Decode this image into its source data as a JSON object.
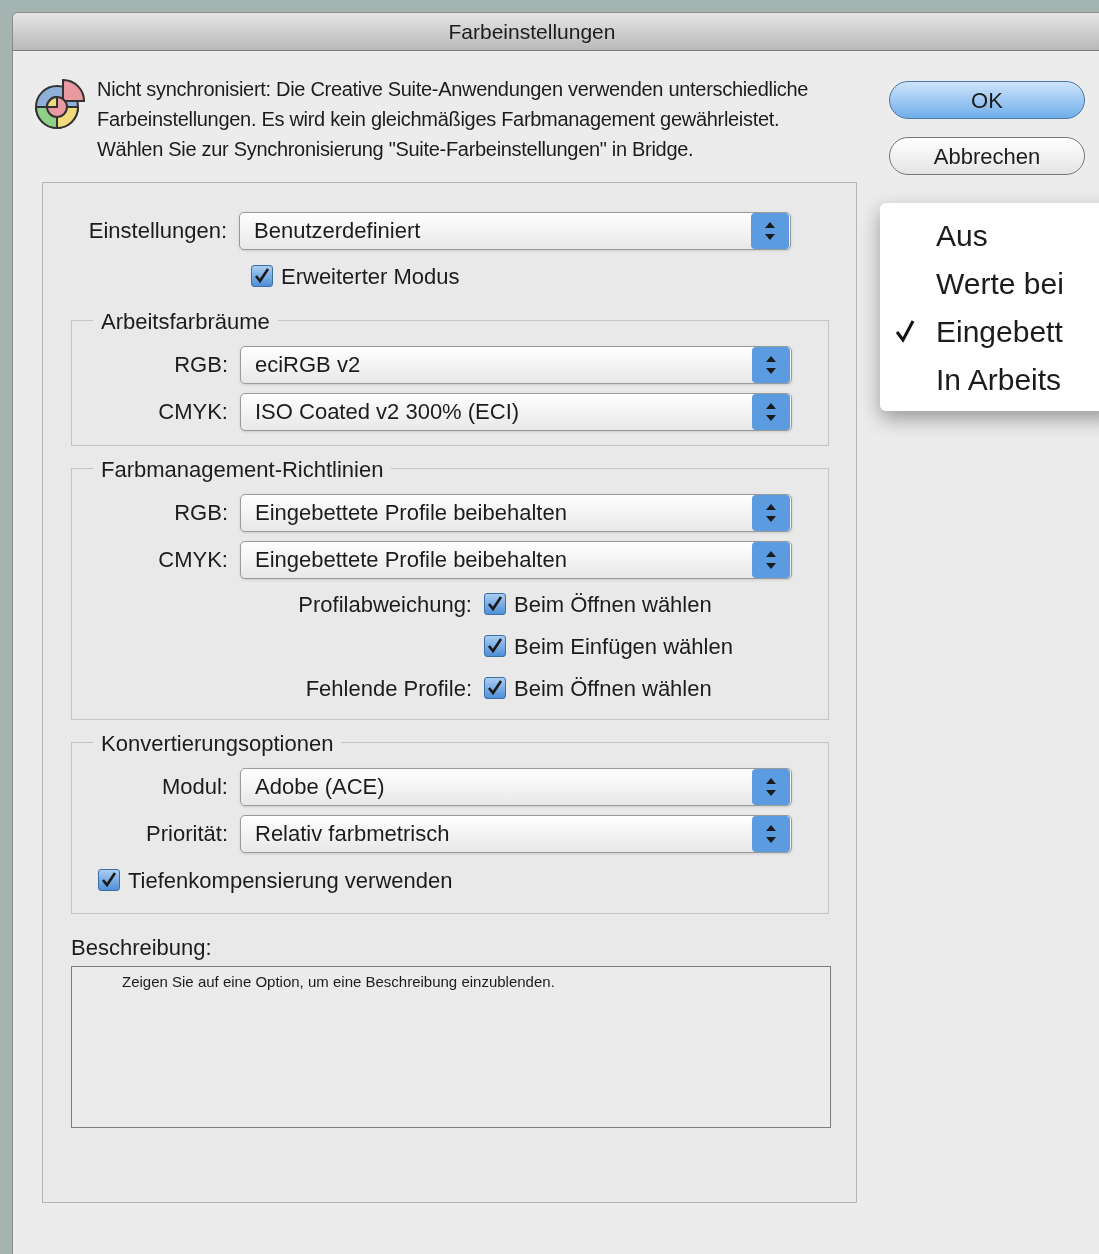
{
  "window": {
    "title": "Farbeinstellungen"
  },
  "message": "Nicht synchronisiert: Die Creative Suite-Anwendungen verwenden unterschiedliche Farbeinstellungen. Es wird kein gleichmäßiges Farbmanagement gewährleistet. Wählen Sie zur Synchronisierung \"Suite-Farbeinstellungen\" in Bridge.",
  "buttons": [
    {
      "label": "OK",
      "default": true
    },
    {
      "label": "Abbrechen",
      "default": false
    }
  ],
  "popup_menu": {
    "items": [
      {
        "label": "Aus",
        "selected": false
      },
      {
        "label": "Werte bei",
        "selected": false
      },
      {
        "label": "Eingebett",
        "selected": true
      },
      {
        "label": "In Arbeits",
        "selected": false
      }
    ]
  },
  "settings": {
    "label": "Einstellungen:",
    "value": "Benutzerdefiniert"
  },
  "advanced_mode": {
    "label": "Erweiterter Modus",
    "checked": true
  },
  "sections": [
    {
      "title": "Arbeitsfarbräume",
      "rows": [
        {
          "kind": "select",
          "label": "RGB:",
          "value": "eciRGB v2"
        },
        {
          "kind": "select",
          "label": "CMYK:",
          "value": "ISO Coated v2 300% (ECI)"
        }
      ]
    },
    {
      "title": "Farbmanagement-Richtlinien",
      "rows": [
        {
          "kind": "select",
          "label": "RGB:",
          "value": "Eingebettete Profile beibehalten"
        },
        {
          "kind": "select",
          "label": "CMYK:",
          "value": "Eingebettete Profile beibehalten"
        },
        {
          "kind": "checkbox",
          "label": "Profilabweichung:",
          "option": "Beim Öffnen wählen",
          "checked": true
        },
        {
          "kind": "checkbox",
          "option": "Beim Einfügen wählen",
          "checked": true
        },
        {
          "kind": "checkbox",
          "label": "Fehlende Profile:",
          "option": "Beim Öffnen wählen",
          "checked": true
        }
      ]
    },
    {
      "title": "Konvertierungsoptionen",
      "rows": [
        {
          "kind": "select",
          "label": "Modul:",
          "value": "Adobe (ACE)"
        },
        {
          "kind": "select",
          "label": "Priorität:",
          "value": "Relativ farbmetrisch"
        },
        {
          "kind": "wide_checkbox",
          "option": "Tiefenkompensierung verwenden",
          "checked": true
        }
      ]
    }
  ],
  "description": {
    "label": "Beschreibung:",
    "text": "Zeigen Sie auf eine Option, um eine Beschreibung einzublenden."
  }
}
